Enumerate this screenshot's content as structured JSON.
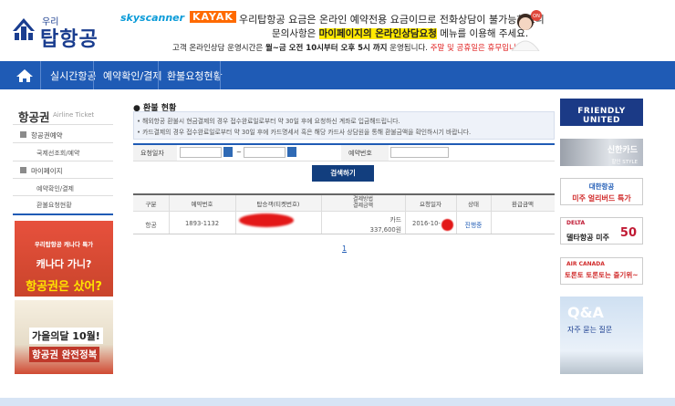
{
  "header": {
    "logo_small": "우리",
    "logo_big": "탑항공",
    "banner": {
      "skyscanner": "skyscanner",
      "kayak": "KAYAK",
      "line1": "우리탑항공 요금은 온라인 예약전용 요금이므로 전화상담이 불가능하오니",
      "line2_pre": "문의사항은 ",
      "line2_highlight": "마이페이지의 온라인상담요청",
      "line2_post": " 메뉴를 이용해 주세요.",
      "line3_pre": "고객 온라인상담 운영시간은 ",
      "line3_bold": "월~금 오전 10시부터 오후 5시 까지",
      "line3_mid": " 운영됩니다. ",
      "line3_red": "주말 및 공휴일은 휴무입니다.",
      "agent_badge": "ON"
    }
  },
  "nav": {
    "home_icon": "home-icon",
    "items": [
      "실시간항공",
      "예약확인/결제",
      "환불요청현황"
    ]
  },
  "sidebar": {
    "title": "항공권",
    "subtitle": "Airline Ticket",
    "items": [
      {
        "label": "항공권예약"
      },
      {
        "label": "국제선조회/예약"
      },
      {
        "label": "마이페이지"
      },
      {
        "label": "예약확인/결제"
      },
      {
        "label": "환불요청현황"
      }
    ],
    "ads": [
      {
        "line1": "우리탑항공 캐나다 특가",
        "line2": "캐나다 가니?",
        "line3": "항공권은 샀어?"
      },
      {
        "line1": "가을의달 10월!",
        "line2": "항공권 완전정복"
      }
    ]
  },
  "main": {
    "section_title": "환불 현황",
    "notice": [
      "해외항공 환불시 현금결제의 경우 접수완료일로부터 약 30일 후에 요청하신 계좌로 입금해드립니다.",
      "카드결제의 경우 접수완료일로부터 약 30일 후에 카드명세서 혹은 해당 카드사 상담원을 통해 환불금액을 확인하시기 바랍니다."
    ],
    "form": {
      "date_label": "요청일자",
      "date_separator": "~",
      "reservation_label": "예약번호",
      "search_button": "검색하기"
    },
    "table": {
      "headers": [
        "구분",
        "예약번호",
        "탑승객(티켓번호)",
        "결제방법\n결제금액",
        "요청일자",
        "상태",
        "환급금액"
      ],
      "rows": [
        {
          "type": "항공",
          "reservation": "1893-1132",
          "passenger": "",
          "payment_method": "카드",
          "payment_amount": "337,600원",
          "request_date": "2016-10-",
          "status": "진행중",
          "refund": ""
        }
      ]
    },
    "pagination": [
      "1"
    ]
  },
  "right_ads": [
    {
      "text": "FRIENDLY UNITED"
    },
    {
      "text": "신한카드",
      "sub": "할인 STYLE"
    },
    {
      "text": "대한항공",
      "sub": "미주 얼리버드 특가"
    },
    {
      "text": "DELTA",
      "sub": "델타항공 미주",
      "num": "50"
    },
    {
      "text": "AIR CANADA",
      "sub": "토론토 토론토는 즐기위~"
    },
    {
      "text": "Q&A",
      "sub": "자주 묻는 질문"
    }
  ],
  "colors": {
    "nav": "#1f5bb5",
    "accent_red": "#e01f1f",
    "search_button": "#123e7e"
  }
}
